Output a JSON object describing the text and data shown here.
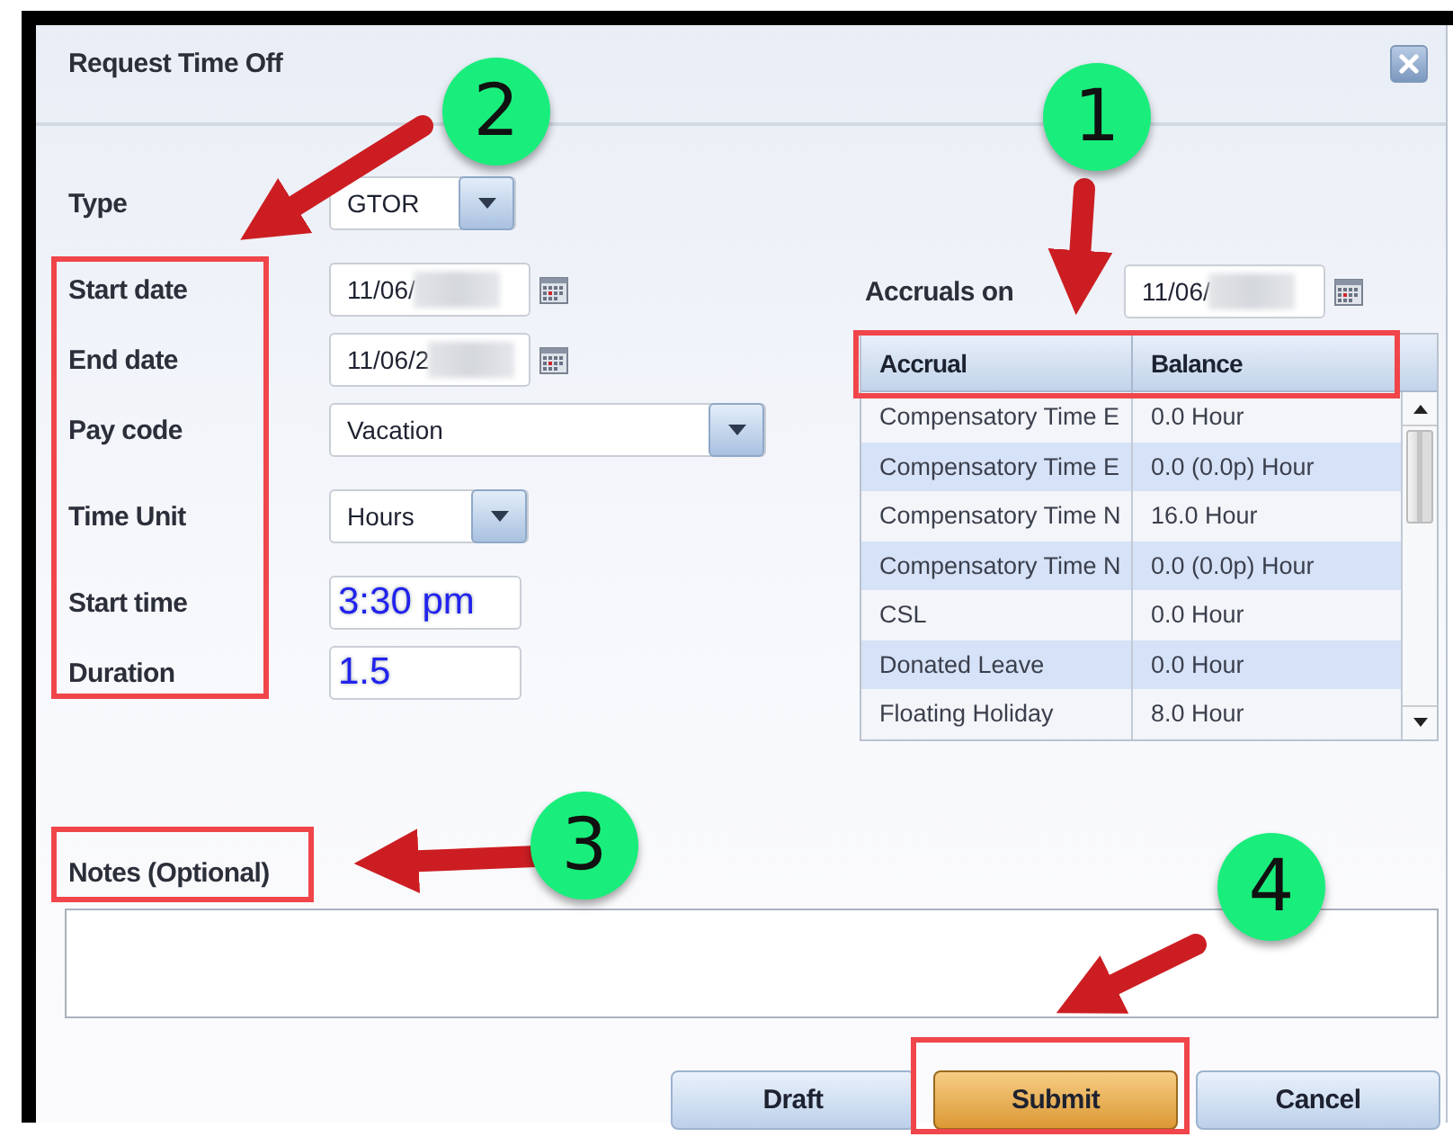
{
  "window": {
    "title": "Request Time Off"
  },
  "form": {
    "fields": [
      {
        "label": "Type",
        "kind": "combo",
        "value": "GTOR"
      },
      {
        "label": "Start date",
        "kind": "date",
        "value": "11/06/"
      },
      {
        "label": "End date",
        "kind": "date",
        "value": "11/06/2"
      },
      {
        "label": "Pay code",
        "kind": "combo_wide",
        "value": "Vacation"
      },
      {
        "label": "Time Unit",
        "kind": "combo",
        "value": "Hours"
      },
      {
        "label": "Start time",
        "kind": "entry",
        "value": "3:30 pm"
      },
      {
        "label": "Duration",
        "kind": "entry",
        "value": "1.5"
      }
    ]
  },
  "accruals": {
    "label": "Accruals on",
    "date": "11/06/",
    "columns": [
      "Accrual",
      "Balance"
    ],
    "rows": [
      [
        "Compensatory Time E",
        "0.0 Hour"
      ],
      [
        "Compensatory Time E",
        "0.0 (0.0p) Hour"
      ],
      [
        "Compensatory Time N",
        "16.0 Hour"
      ],
      [
        "Compensatory Time N",
        "0.0 (0.0p) Hour"
      ],
      [
        "CSL",
        "0.0 Hour"
      ],
      [
        "Donated Leave",
        "0.0 Hour"
      ],
      [
        "Floating Holiday",
        "8.0 Hour"
      ]
    ]
  },
  "notes": {
    "label": "Notes (Optional)"
  },
  "buttons": [
    {
      "label": "Draft",
      "kind": "secondary"
    },
    {
      "label": "Submit",
      "kind": "primary"
    },
    {
      "label": "Cancel",
      "kind": "secondary"
    }
  ],
  "callouts": [
    {
      "number": "1"
    },
    {
      "number": "2"
    },
    {
      "number": "3"
    },
    {
      "number": "4"
    }
  ]
}
